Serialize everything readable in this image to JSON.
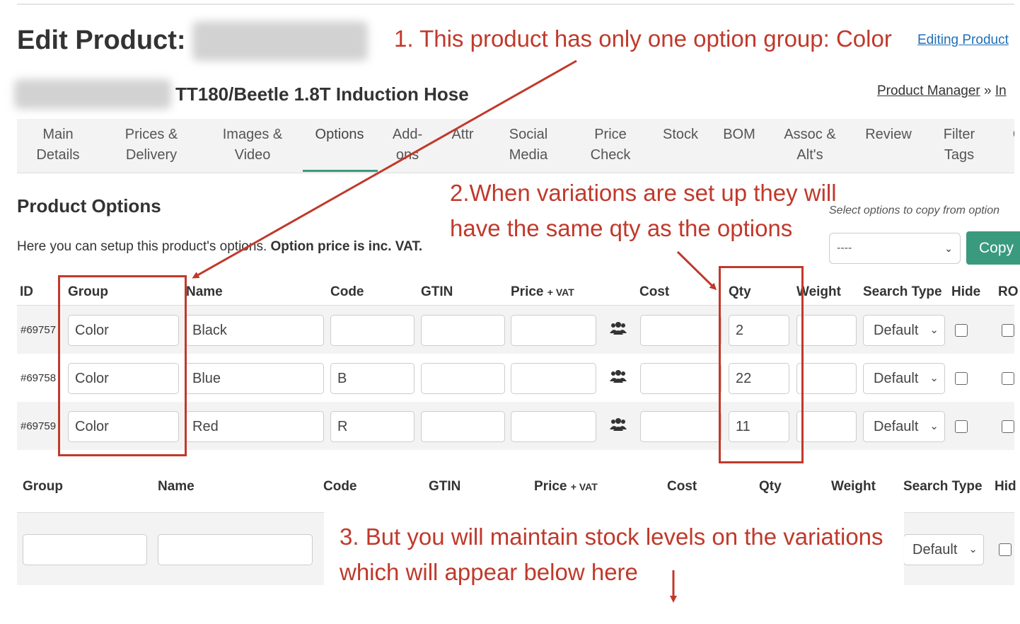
{
  "page": {
    "title": "Edit Product:",
    "editing_link": "Editing Product",
    "product_name": "TT180/Beetle 1.8T Induction Hose",
    "breadcrumb": {
      "link": "Product Manager",
      "sep": "»",
      "next": "In"
    }
  },
  "tabs": [
    {
      "line1": "Main",
      "line2": "Details"
    },
    {
      "line1": "Prices &",
      "line2": "Delivery"
    },
    {
      "line1": "Images &",
      "line2": "Video"
    },
    {
      "line1": "Options",
      "line2": ""
    },
    {
      "line1": "Add-",
      "line2": "ons"
    },
    {
      "line1": "Attr",
      "line2": ""
    },
    {
      "line1": "Social",
      "line2": "Media"
    },
    {
      "line1": "Price",
      "line2": "Check"
    },
    {
      "line1": "Stock",
      "line2": ""
    },
    {
      "line1": "BOM",
      "line2": ""
    },
    {
      "line1": "Assoc &",
      "line2": "Alt's"
    },
    {
      "line1": "Review",
      "line2": ""
    },
    {
      "line1": "Filter",
      "line2": "Tags"
    },
    {
      "line1": "C",
      "line2": ""
    }
  ],
  "active_tab": "Options",
  "section": {
    "heading": "Product Options",
    "description": "Here you can setup this product's options.",
    "description_bold": "Option price is inc. VAT."
  },
  "copy": {
    "hint": "Select options to copy from option",
    "select_value": "----",
    "button": "Copy"
  },
  "table": {
    "headers": {
      "id": "ID",
      "group": "Group",
      "name": "Name",
      "code": "Code",
      "gtin": "GTIN",
      "price": "Price",
      "price_suffix": "+ VAT",
      "cost": "Cost",
      "qty": "Qty",
      "weight": "Weight",
      "search_type": "Search Type",
      "hide": "Hide",
      "ro": "RO"
    },
    "rows": [
      {
        "id": "#69757",
        "group": "Color",
        "name": "Black",
        "code": "",
        "gtin": "",
        "price": "",
        "cost": "",
        "qty": "2",
        "weight": "",
        "search_type": "Default"
      },
      {
        "id": "#69758",
        "group": "Color",
        "name": "Blue",
        "code": "B",
        "gtin": "",
        "price": "",
        "cost": "",
        "qty": "22",
        "weight": "",
        "search_type": "Default"
      },
      {
        "id": "#69759",
        "group": "Color",
        "name": "Red",
        "code": "R",
        "gtin": "",
        "price": "",
        "cost": "",
        "qty": "11",
        "weight": "",
        "search_type": "Default"
      }
    ]
  },
  "new_option": {
    "headers": {
      "group": "Group",
      "name": "Name",
      "code": "Code",
      "gtin": "GTIN",
      "price": "Price",
      "price_suffix": "+ VAT",
      "cost": "Cost",
      "qty": "Qty",
      "weight": "Weight",
      "search_type": "Search Type",
      "hide": "Hid"
    },
    "search_type": "Default"
  },
  "annotations": {
    "note1": "1. This product has only one option group: Color",
    "note2_line1": "2.When variations are set up they will",
    "note2_line2": "have the same qty as the options",
    "note3_line1": "3. But you will maintain stock levels on the variations",
    "note3_line2": "which will appear below here",
    "color": "#c0392b"
  },
  "icons": {
    "people": "users-icon",
    "select_chevron": "chevron-down-icon"
  }
}
